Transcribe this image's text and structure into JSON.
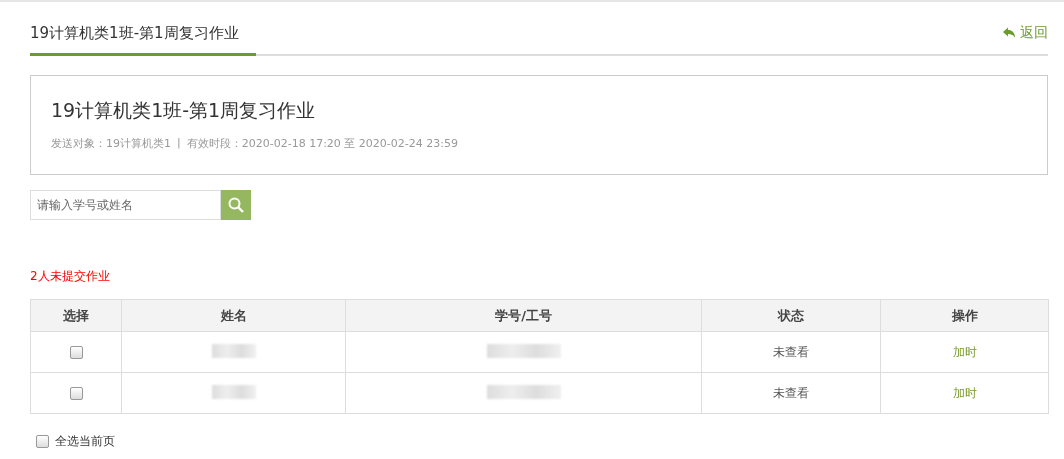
{
  "header": {
    "tab": "19计算机类1班-第1周复习作业",
    "back_link": "返回"
  },
  "info": {
    "title": "19计算机类1班-第1周复习作业",
    "recipients_label": "发送对象：",
    "recipients": "19计算机类1",
    "separator": "|",
    "period_label": "有效时段：",
    "period_start": "2020-02-18 17:20",
    "period_to": "至",
    "period_end": "2020-02-24 23:59"
  },
  "search": {
    "placeholder": "请输入学号或姓名"
  },
  "notice": "2人未提交作业",
  "table": {
    "columns": [
      "选择",
      "姓名",
      "学号/工号",
      "状态",
      "操作"
    ],
    "rows": [
      {
        "checked": false,
        "status": "未查看",
        "action": "加时"
      },
      {
        "checked": false,
        "status": "未查看",
        "action": "加时"
      }
    ]
  },
  "select_all": {
    "label": "全选当前页",
    "checked": false
  }
}
